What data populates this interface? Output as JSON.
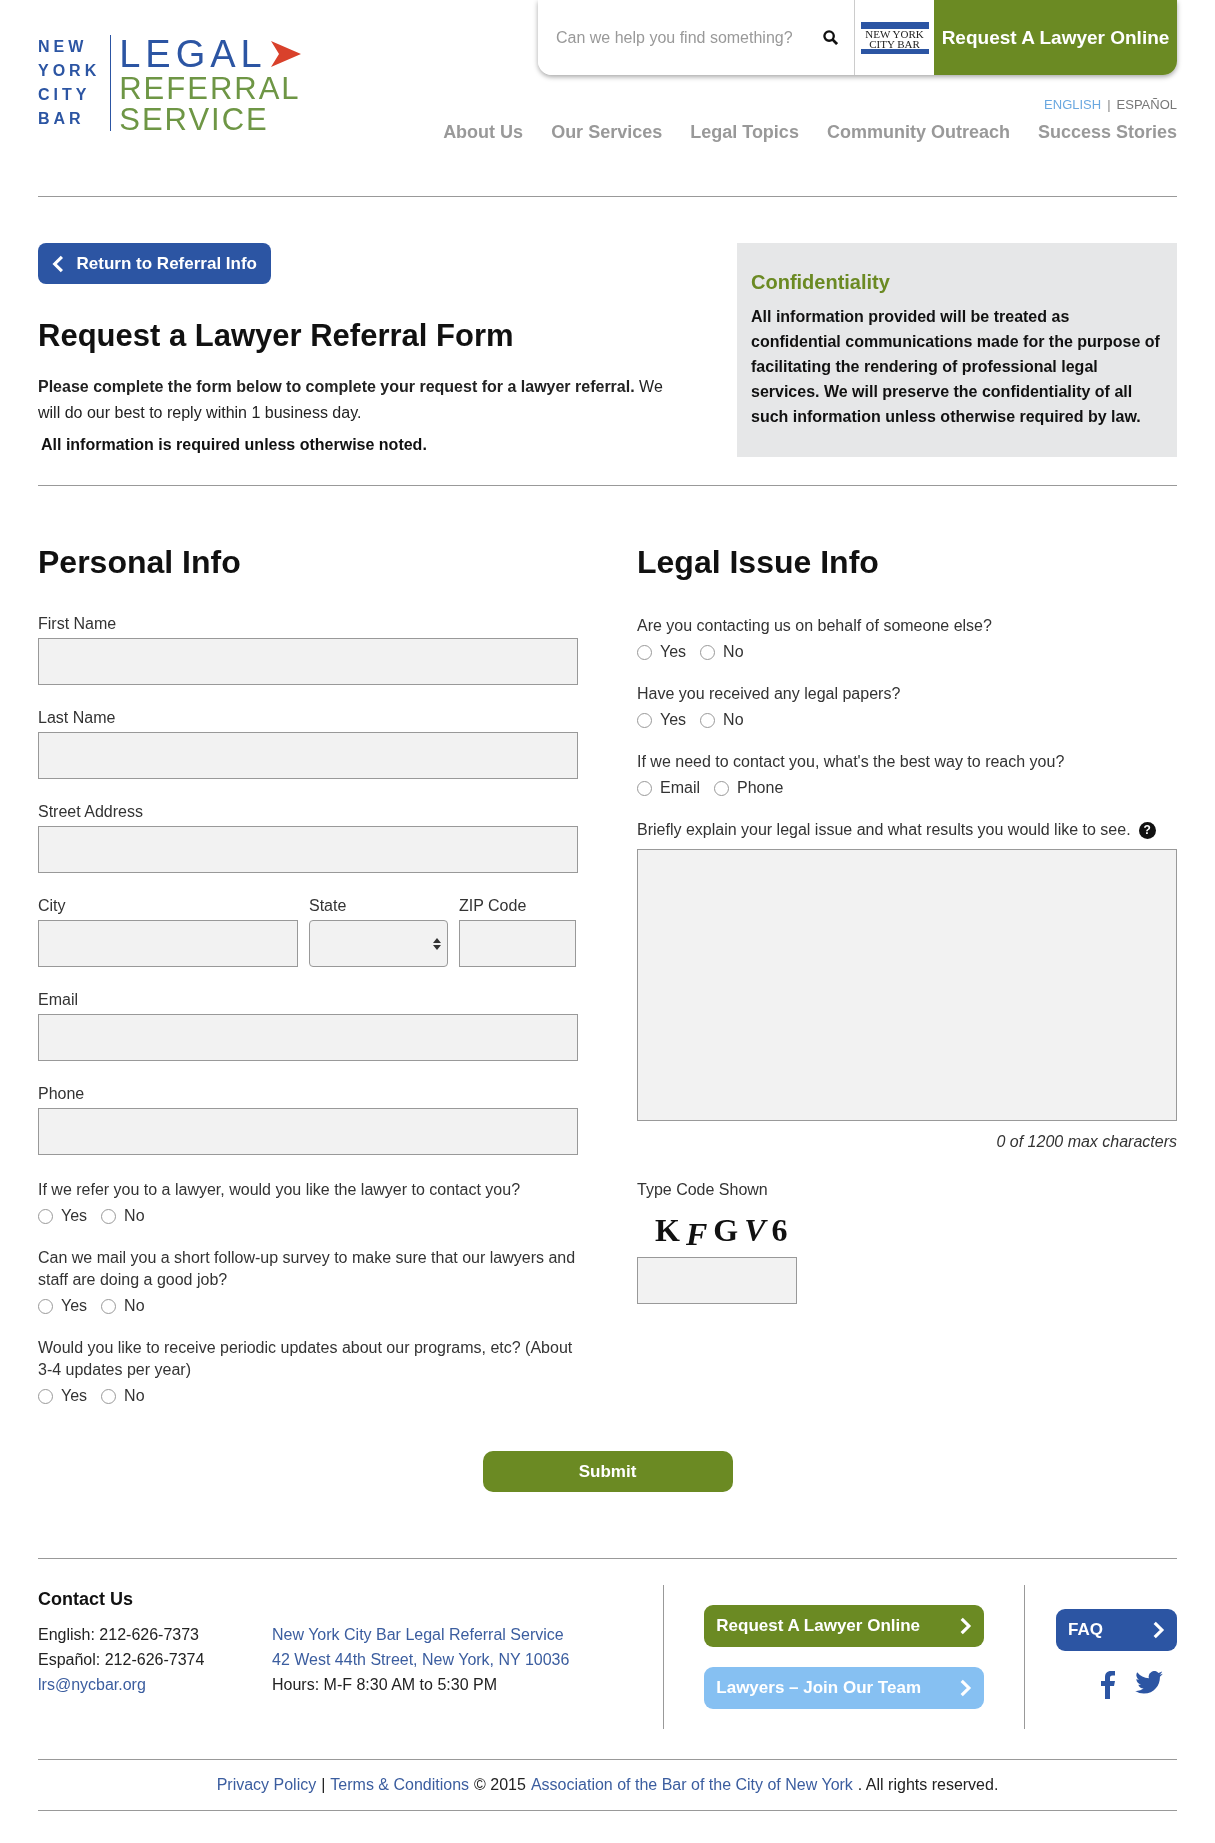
{
  "logo": {
    "city_lines": [
      "NEW",
      "YORK",
      "CITY",
      "BAR"
    ],
    "word_lines": [
      "LEGAL",
      "REFERRAL",
      "SERVICE"
    ]
  },
  "header": {
    "search": {
      "placeholder": "Can we help you find something?"
    },
    "badge_lines": [
      "NEW YORK",
      "CITY BAR"
    ],
    "cta": "Request A Lawyer Online",
    "languages": [
      {
        "label": "ENGLISH",
        "selected": true
      },
      {
        "label": "ESPAÑOL",
        "selected": false
      }
    ],
    "language_separator": "|",
    "nav": [
      "About Us",
      "Our Services",
      "Legal Topics",
      "Community Outreach",
      "Success Stories"
    ]
  },
  "intro": {
    "back_button": "Return to Referral Info",
    "title": "Request a Lawyer Referral Form",
    "lead": "**Please complete the form below to complete your request for a lawyer referral.** We will do our best to reply within 1 business day.",
    "note": "All information is required unless otherwise noted.",
    "confidentiality": {
      "title": "Confidentiality",
      "text": "All information provided will be treated as confidential communications made for the purpose of facilitating the rendering of professional legal services. We will preserve the confidentiality of all such information unless otherwise required by law."
    }
  },
  "personal": {
    "heading": "Personal Info",
    "fields": [
      {
        "label": "First Name",
        "kind": "text"
      },
      {
        "label": "Last Name",
        "kind": "text"
      },
      {
        "label": "Street Address",
        "kind": "text"
      },
      {
        "kind": "address_row",
        "parts": [
          {
            "label": "City",
            "kind": "text"
          },
          {
            "label": "State",
            "kind": "select"
          },
          {
            "label": "ZIP Code",
            "kind": "text"
          }
        ]
      },
      {
        "label": "Email",
        "kind": "text"
      },
      {
        "label": "Phone",
        "kind": "text"
      }
    ],
    "questions": [
      {
        "question": "If we refer you to a lawyer, would you like the lawyer to contact you?",
        "options": [
          {
            "label": "Yes",
            "selected": false
          },
          {
            "label": "No",
            "selected": false
          }
        ]
      },
      {
        "question": "Can we mail you a short follow-up survey to make sure that our lawyers and staff are doing a good job?",
        "options": [
          {
            "label": "Yes",
            "selected": false
          },
          {
            "label": "No",
            "selected": false
          }
        ]
      },
      {
        "question": "Would you like to receive periodic updates about our programs, etc? (About 3-4 updates per year)",
        "options": [
          {
            "label": "Yes",
            "selected": false
          },
          {
            "label": "No",
            "selected": false
          }
        ]
      }
    ]
  },
  "legal": {
    "heading": "Legal Issue Info",
    "questions": [
      {
        "question": "Are you contacting us on behalf of someone else?",
        "options": [
          {
            "label": "Yes",
            "selected": false
          },
          {
            "label": "No",
            "selected": false
          }
        ]
      },
      {
        "question": "Have you received any legal papers?",
        "options": [
          {
            "label": "Yes",
            "selected": false
          },
          {
            "label": "No",
            "selected": false
          }
        ]
      },
      {
        "question": "If we need to contact you, what's the best way to reach you?",
        "options": [
          {
            "label": "Email",
            "selected": false
          },
          {
            "label": "Phone",
            "selected": false
          }
        ]
      }
    ],
    "explain_label": "Briefly explain your legal issue and what results you would like to see.",
    "help_mark": "?",
    "counter": "0 of 1200 max characters",
    "captcha_label": "Type Code Shown",
    "captcha": [
      "K",
      "F",
      "G",
      "V",
      "6"
    ]
  },
  "submit": "Submit",
  "footer": {
    "contact_heading": "Contact Us",
    "phones": [
      "English: 212-626-7373",
      "Español: 212-626-7374"
    ],
    "email": "lrs@nycbar.org",
    "address": [
      {
        "text": "New York City Bar Legal Referral Service",
        "kind": "link"
      },
      {
        "text": "42 West 44th Street, New York, NY 10036",
        "kind": "link"
      },
      {
        "text": "Hours: M-F 8:30 AM to 5:30 PM",
        "kind": "text"
      }
    ],
    "buttons": [
      {
        "label": "Request A Lawyer Online",
        "color": "#6b8a23"
      },
      {
        "label": "Lawyers – Join Our Team",
        "color": "#86c0f2"
      }
    ],
    "faq": "FAQ",
    "legal_line": [
      {
        "text": "Privacy Policy",
        "kind": "link"
      },
      {
        "text": "|",
        "kind": "text"
      },
      {
        "text": "Terms & Conditions",
        "kind": "link"
      },
      {
        "text": "© 2015",
        "kind": "text"
      },
      {
        "text": "Association of the Bar of the City of New York",
        "kind": "link"
      },
      {
        "text": ". All rights reserved.",
        "kind": "text"
      }
    ]
  }
}
